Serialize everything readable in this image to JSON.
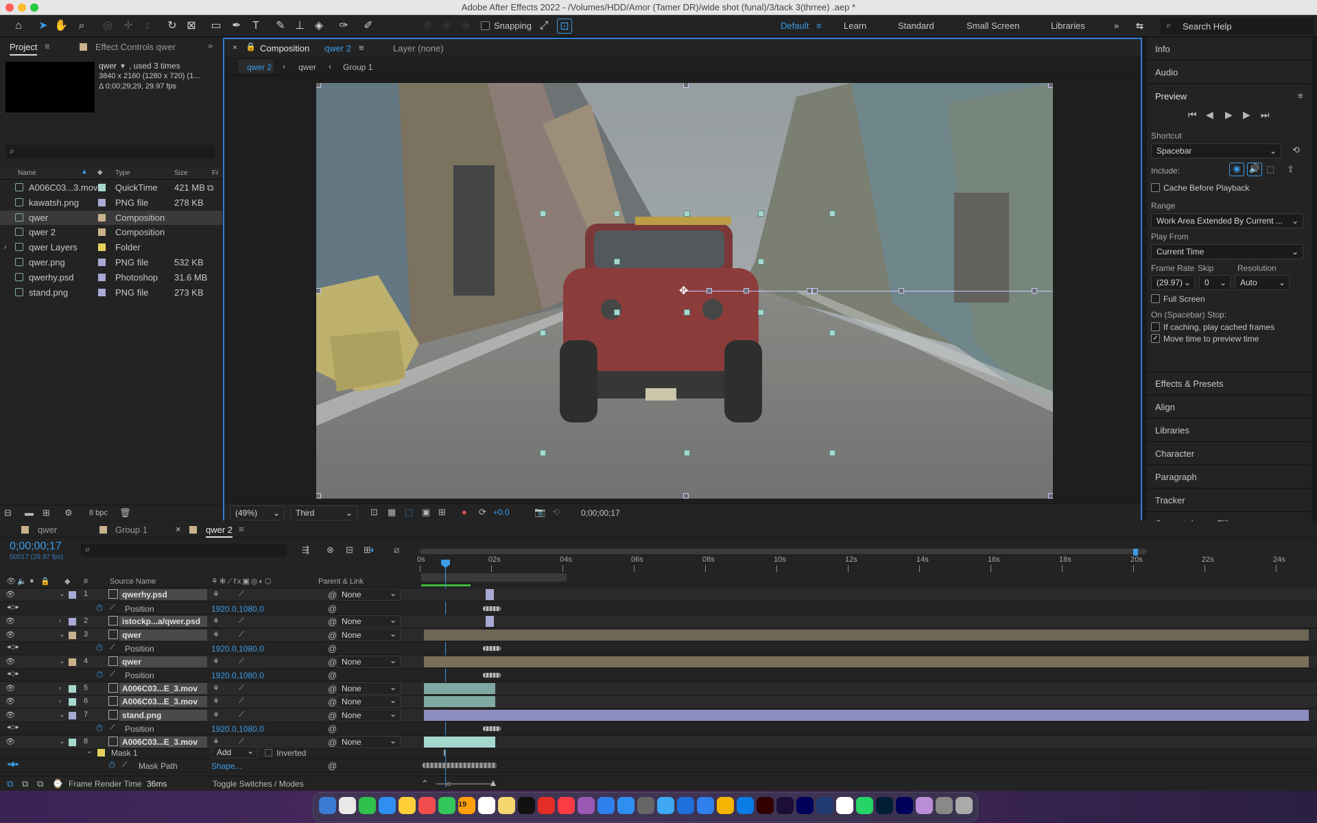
{
  "window": {
    "title": "Adobe After Effects 2022 - /Volumes/HDD/Amor (Tamer DR)/wide shot (funal)/3/tack 3(thrree) .aep *"
  },
  "toolbar": {
    "snapping_label": "Snapping",
    "workspaces": [
      "Default",
      "Learn",
      "Standard",
      "Small Screen",
      "Libraries"
    ],
    "search_placeholder": "Search Help"
  },
  "project_panel": {
    "tab_project": "Project",
    "tab_effect_controls": "Effect Controls qwer",
    "selected_name": "qwer",
    "selected_usage": ", used 3 times",
    "selected_dims": "3840 x 2160  (1280 x 720) (1...",
    "selected_duration": "Δ 0;00;29;29, 29.97 fps",
    "columns": {
      "name": "Name",
      "type": "Type",
      "size": "Size",
      "fr": "Fr"
    },
    "items": [
      {
        "name": "A006C03...3.mov",
        "type": "QuickTime",
        "size": "421 MB",
        "color": "#a6d7cf"
      },
      {
        "name": "kawatsh.png",
        "type": "PNG file",
        "size": "278 KB",
        "color": "#a9a9d6"
      },
      {
        "name": "qwer",
        "type": "Composition",
        "size": "",
        "color": "#c8b28c"
      },
      {
        "name": "qwer 2",
        "type": "Composition",
        "size": "",
        "color": "#c8b28c"
      },
      {
        "name": "qwer Layers",
        "type": "Folder",
        "size": "",
        "color": "#e6d25a"
      },
      {
        "name": "qwer.png",
        "type": "PNG file",
        "size": "532 KB",
        "color": "#a9a9d6"
      },
      {
        "name": "qwerhy.psd",
        "type": "Photoshop",
        "size": "31.6 MB",
        "color": "#a9a9d6"
      },
      {
        "name": "stand.png",
        "type": "PNG file",
        "size": "273 KB",
        "color": "#a9a9d6"
      }
    ],
    "bpc": "8 bpc"
  },
  "comp_panel": {
    "tab_label": "Composition",
    "tab_comp": "qwer 2",
    "layer_tab": "Layer (none)",
    "breadcrumbs": [
      "qwer 2",
      "qwer",
      "Group 1"
    ],
    "zoom": "(49%)",
    "resolution": "Third",
    "exposure": "+0.0",
    "timecode": "0;00;00;17"
  },
  "right_panel": {
    "info": "Info",
    "audio": "Audio",
    "preview": "Preview",
    "shortcut_label": "Shortcut",
    "shortcut_value": "Spacebar",
    "include_label": "Include:",
    "cache_label": "Cache Before Playback",
    "range_label": "Range",
    "range_value": "Work Area Extended By Current ...",
    "playfrom_label": "Play From",
    "playfrom_value": "Current Time",
    "framerate_label": "Frame Rate",
    "skip_label": "Skip",
    "resolution_label": "Resolution",
    "framerate_value": "(29.97)",
    "skip_value": "0",
    "resolution_value": "Auto",
    "fullscreen_label": "Full Screen",
    "stop_label": "On (Spacebar) Stop:",
    "ifcaching_label": "If caching, play cached frames",
    "movetime_label": "Move time to preview time",
    "sections": [
      "Effects & Presets",
      "Align",
      "Libraries",
      "Character",
      "Paragraph",
      "Tracker",
      "Content-Aware Fill"
    ]
  },
  "timeline": {
    "tabs": [
      "qwer",
      "Group 1",
      "qwer 2"
    ],
    "timecode": "0;00;00;17",
    "fps_note": "00017 (29.97 fps)",
    "col_source": "Source Name",
    "col_parent": "Parent & Link",
    "ruler": [
      "0s",
      "02s",
      "04s",
      "06s",
      "08s",
      "10s",
      "12s",
      "14s",
      "16s",
      "18s",
      "20s",
      "22s",
      "24s"
    ],
    "layers": [
      {
        "num": "1",
        "name": "qwerhy.psd",
        "parent": "None",
        "color": "#a9a9d6"
      },
      {
        "prop": "Position",
        "value": "1920.0,1080.0"
      },
      {
        "num": "2",
        "name": "istockp...a/qwer.psd",
        "parent": "None",
        "color": "#a9a9d6"
      },
      {
        "num": "3",
        "name": "qwer",
        "parent": "None",
        "color": "#c8b28c"
      },
      {
        "prop": "Position",
        "value": "1920.0,1080.0"
      },
      {
        "num": "4",
        "name": "qwer",
        "parent": "None",
        "color": "#c8b28c"
      },
      {
        "prop": "Position",
        "value": "1920.0,1080.0"
      },
      {
        "num": "5",
        "name": "A006C03...E_3.mov",
        "parent": "None",
        "color": "#a6d7cf"
      },
      {
        "num": "6",
        "name": "A006C03...E_3.mov",
        "parent": "None",
        "color": "#a6d7cf"
      },
      {
        "num": "7",
        "name": "stand.png",
        "parent": "None",
        "color": "#a9a9d6"
      },
      {
        "prop": "Position",
        "value": "1920.0,1080.0"
      },
      {
        "num": "8",
        "name": "A006C03...E_3.mov",
        "parent": "None",
        "color": "#a6d7cf"
      }
    ],
    "mask": {
      "name": "Mask 1",
      "mode": "Add",
      "inverted": "Inverted",
      "path_label": "Mask Path",
      "path_value": "Shape..."
    },
    "footer_render": "Frame Render Time",
    "footer_render_value": "36ms",
    "footer_toggle": "Toggle Switches / Modes"
  },
  "dock": {
    "calendar_day": "19"
  }
}
